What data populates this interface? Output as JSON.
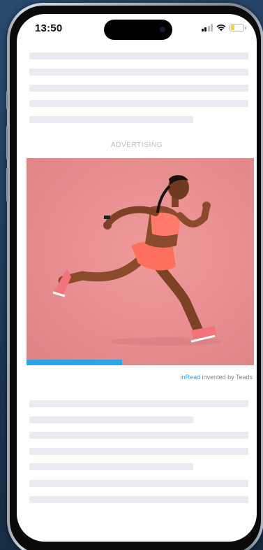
{
  "status_bar": {
    "time": "13:50",
    "icons": [
      "signal-icon",
      "wifi-icon",
      "battery-icon"
    ],
    "battery_color": "#f3d23a"
  },
  "ad": {
    "label": "ADVERTISING",
    "image_subject": "runner-photo",
    "progress": 0.42,
    "progress_color": "#2aa6e6",
    "credit_brand": "inRead",
    "credit_text": " invented by Teads"
  }
}
